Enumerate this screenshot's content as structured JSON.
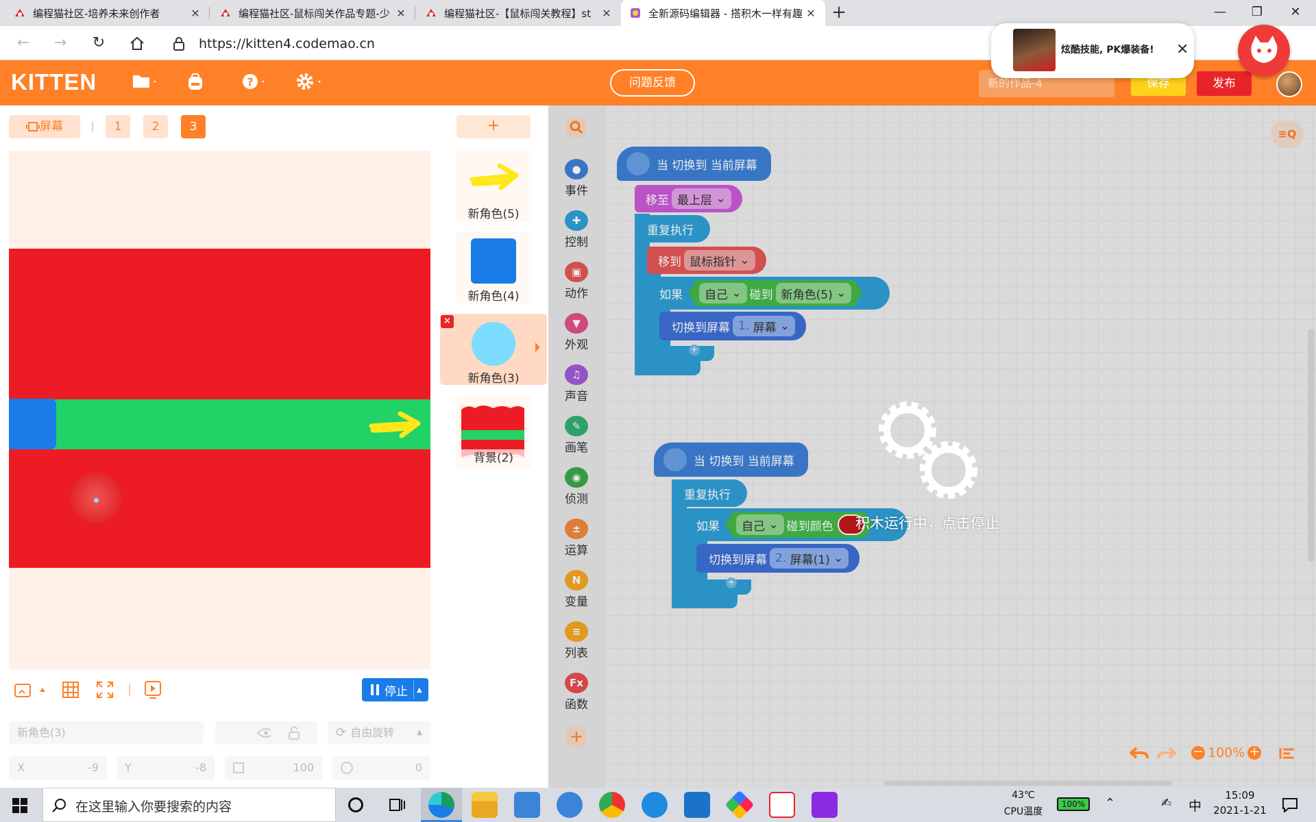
{
  "browser": {
    "tabs": [
      {
        "title": "编程猫社区-培养未来创作者"
      },
      {
        "title": "编程猫社区-鼠标闯关作品专题-少"
      },
      {
        "title": "编程猫社区-【鼠标闯关教程】st"
      },
      {
        "title": "全新源码编辑器 - 搭积木一样有趣"
      }
    ],
    "new_tab": "+",
    "window": {
      "minimize": "—",
      "restore": "❐",
      "close": "✕"
    },
    "url": "https://kitten4.codemao.cn"
  },
  "ad": {
    "text": "炫酷技能, PK爆装备!",
    "close": "✕"
  },
  "app": {
    "logo": "KITTEN",
    "feedback_button": "问题反馈",
    "project_title_placeholder": "新的作品-4",
    "save_button": "保存",
    "publish_button": "发布"
  },
  "stage": {
    "screen_button": "屏幕",
    "screens": [
      "1",
      "2",
      "3"
    ],
    "active_screen": "3",
    "stop_button": "停止",
    "sprite_name_placeholder": "新角色(3)",
    "rotation_label": "自由旋转",
    "x_label": "X",
    "x_value": "-9",
    "y_label": "Y",
    "y_value": "-8",
    "size_value": "100",
    "direction_value": "0",
    "colors": {
      "red": "#ed1c24",
      "green": "#22d266",
      "blue": "#1a7ce8"
    }
  },
  "sprites": {
    "add": "+",
    "items": [
      {
        "name": "新角色(5)"
      },
      {
        "name": "新角色(4)"
      },
      {
        "name": "新角色(3)"
      },
      {
        "name": "背景(2)"
      }
    ]
  },
  "categories": [
    {
      "label": "事件",
      "color": "#3d7fd6"
    },
    {
      "label": "控制",
      "color": "#2f9fd6"
    },
    {
      "label": "动作",
      "color": "#e45656"
    },
    {
      "label": "外观",
      "color": "#e0508a"
    },
    {
      "label": "声音",
      "color": "#a25cd6"
    },
    {
      "label": "画笔",
      "color": "#30b070"
    },
    {
      "label": "侦测",
      "color": "#3aa84a"
    },
    {
      "label": "运算",
      "color": "#f0883c"
    },
    {
      "label": "变量",
      "color": "#f5a623"
    },
    {
      "label": "列表",
      "color": "#f5a623"
    },
    {
      "label": "函数",
      "color": "#e84c4c"
    }
  ],
  "script1": {
    "hat": "当 切换到 当前屏幕",
    "move_to_layer": "移至",
    "layer_value": "最上层",
    "repeat": "重复执行",
    "move_to": "移到",
    "mouse_value": "鼠标指针",
    "if_label": "如果",
    "self_value": "自己",
    "touch_label": "碰到",
    "touch_target": "新角色(5)",
    "switch_label": "切换到屏幕",
    "screen_num": "1.",
    "screen_value": "屏幕"
  },
  "script2": {
    "hat": "当 切换到 当前屏幕",
    "repeat": "重复执行",
    "if_label": "如果",
    "self_value": "自己",
    "touch_color_label": "碰到颜色",
    "switch_label": "切换到屏幕",
    "screen_num": "2.",
    "screen_value": "屏幕(1)"
  },
  "running_message": "积木运行中，点击停止",
  "zoom": {
    "level": "100%",
    "minus": "−",
    "plus": "+"
  },
  "taskbar": {
    "search_placeholder": "在这里输入你要搜索的内容",
    "temperature": "43℃",
    "temp_label": "CPU温度",
    "battery": "100%",
    "ime": "中",
    "time": "15:09",
    "date": "2021-1-21"
  }
}
